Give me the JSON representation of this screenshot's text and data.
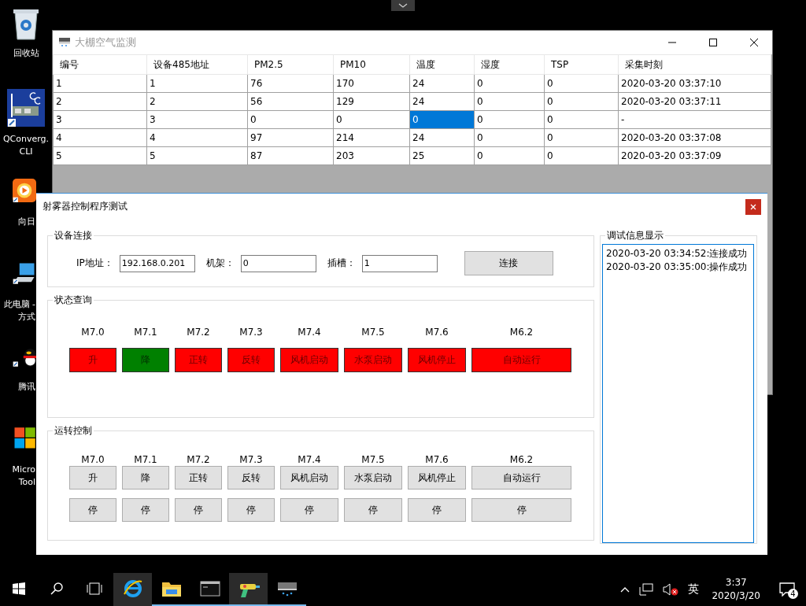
{
  "desktop_icons": [
    {
      "kind": "recycle-bin",
      "label_lines": [
        "回收站"
      ]
    },
    {
      "kind": "network-card",
      "label_lines": [
        "QConverg.",
        "CLI"
      ]
    },
    {
      "kind": "sunflower",
      "label_lines": [
        "向日"
      ]
    },
    {
      "kind": "computer",
      "label_lines": [
        "此电脑 -",
        "方式"
      ]
    },
    {
      "kind": "penguin",
      "label_lines": [
        "腾讯"
      ]
    },
    {
      "kind": "tiles",
      "label_lines": [
        "Micro",
        "Tool"
      ]
    }
  ],
  "monitor_window": {
    "title": "大棚空气监测",
    "columns": [
      "编号",
      "设备485地址",
      "PM2.5",
      "PM10",
      "温度",
      "湿度",
      "TSP",
      "采集时刻"
    ],
    "rows": [
      [
        {
          "text": "1",
          "selected": false
        },
        {
          "text": "1",
          "selected": false
        },
        {
          "text": "76",
          "selected": false
        },
        {
          "text": "170",
          "selected": false
        },
        {
          "text": "24",
          "selected": false
        },
        {
          "text": "0",
          "selected": false
        },
        {
          "text": "0",
          "selected": false
        },
        {
          "text": "2020-03-20 03:37:10",
          "selected": false
        }
      ],
      [
        {
          "text": "2",
          "selected": false
        },
        {
          "text": "2",
          "selected": false
        },
        {
          "text": "56",
          "selected": false
        },
        {
          "text": "129",
          "selected": false
        },
        {
          "text": "24",
          "selected": false
        },
        {
          "text": "0",
          "selected": false
        },
        {
          "text": "0",
          "selected": false
        },
        {
          "text": "2020-03-20 03:37:11",
          "selected": false
        }
      ],
      [
        {
          "text": "3",
          "selected": false
        },
        {
          "text": "3",
          "selected": false
        },
        {
          "text": "0",
          "selected": false
        },
        {
          "text": "0",
          "selected": false
        },
        {
          "text": "0",
          "selected": true
        },
        {
          "text": "0",
          "selected": false
        },
        {
          "text": "0",
          "selected": false
        },
        {
          "text": "-",
          "selected": false
        }
      ],
      [
        {
          "text": "4",
          "selected": false
        },
        {
          "text": "4",
          "selected": false
        },
        {
          "text": "97",
          "selected": false
        },
        {
          "text": "214",
          "selected": false
        },
        {
          "text": "24",
          "selected": false
        },
        {
          "text": "0",
          "selected": false
        },
        {
          "text": "0",
          "selected": false
        },
        {
          "text": "2020-03-20 03:37:08",
          "selected": false
        }
      ],
      [
        {
          "text": "5",
          "selected": false
        },
        {
          "text": "5",
          "selected": false
        },
        {
          "text": "87",
          "selected": false
        },
        {
          "text": "203",
          "selected": false
        },
        {
          "text": "25",
          "selected": false
        },
        {
          "text": "0",
          "selected": false
        },
        {
          "text": "0",
          "selected": false
        },
        {
          "text": "2020-03-20 03:37:09",
          "selected": false
        }
      ]
    ]
  },
  "control_window": {
    "title": "射雾器控制程序测试",
    "connection": {
      "title": "设备连接",
      "fields": [
        {
          "label": "IP地址：",
          "value": "192.168.0.201"
        },
        {
          "label": "机架：",
          "value": "0"
        },
        {
          "label": "插槽：",
          "value": "1"
        }
      ],
      "button": "连接"
    },
    "status": {
      "title": "状态查询",
      "items": [
        {
          "address": "M7.0",
          "label": "升",
          "on": false
        },
        {
          "address": "M7.1",
          "label": "降",
          "on": true
        },
        {
          "address": "M7.2",
          "label": "正转",
          "on": false
        },
        {
          "address": "M7.3",
          "label": "反转",
          "on": false
        },
        {
          "address": "M7.4",
          "label": "风机启动",
          "on": false
        },
        {
          "address": "M7.5",
          "label": "水泵启动",
          "on": false
        },
        {
          "address": "M7.6",
          "label": "风机停止",
          "on": false
        },
        {
          "address": "M6.2",
          "label": "自动运行",
          "on": false
        }
      ]
    },
    "control": {
      "title": "运转控制",
      "items": [
        {
          "address": "M7.0",
          "start": "升",
          "stop": "停"
        },
        {
          "address": "M7.1",
          "start": "降",
          "stop": "停"
        },
        {
          "address": "M7.2",
          "start": "正转",
          "stop": "停"
        },
        {
          "address": "M7.3",
          "start": "反转",
          "stop": "停"
        },
        {
          "address": "M7.4",
          "start": "风机启动",
          "stop": "停"
        },
        {
          "address": "M7.5",
          "start": "水泵启动",
          "stop": "停"
        },
        {
          "address": "M7.6",
          "start": "风机停止",
          "stop": "停"
        },
        {
          "address": "M6.2",
          "start": "自动运行",
          "stop": "停"
        }
      ]
    },
    "debug": {
      "title": "调试信息显示",
      "lines": [
        "2020-03-20 03:34:52:连接成功",
        "2020-03-20 03:35:00:操作成功"
      ]
    }
  },
  "taskbar": {
    "apps": [
      {
        "kind": "browser",
        "highlighted": true,
        "running": false
      },
      {
        "kind": "folder",
        "highlighted": false,
        "running": true
      },
      {
        "kind": "terminal",
        "highlighted": false,
        "running": true
      },
      {
        "kind": "spray-gun",
        "highlighted": true,
        "running": true
      },
      {
        "kind": "monitor",
        "highlighted": false,
        "running": true
      }
    ],
    "ime": "英",
    "time": "3:37",
    "date": "2020/3/20",
    "notifications": "4"
  }
}
